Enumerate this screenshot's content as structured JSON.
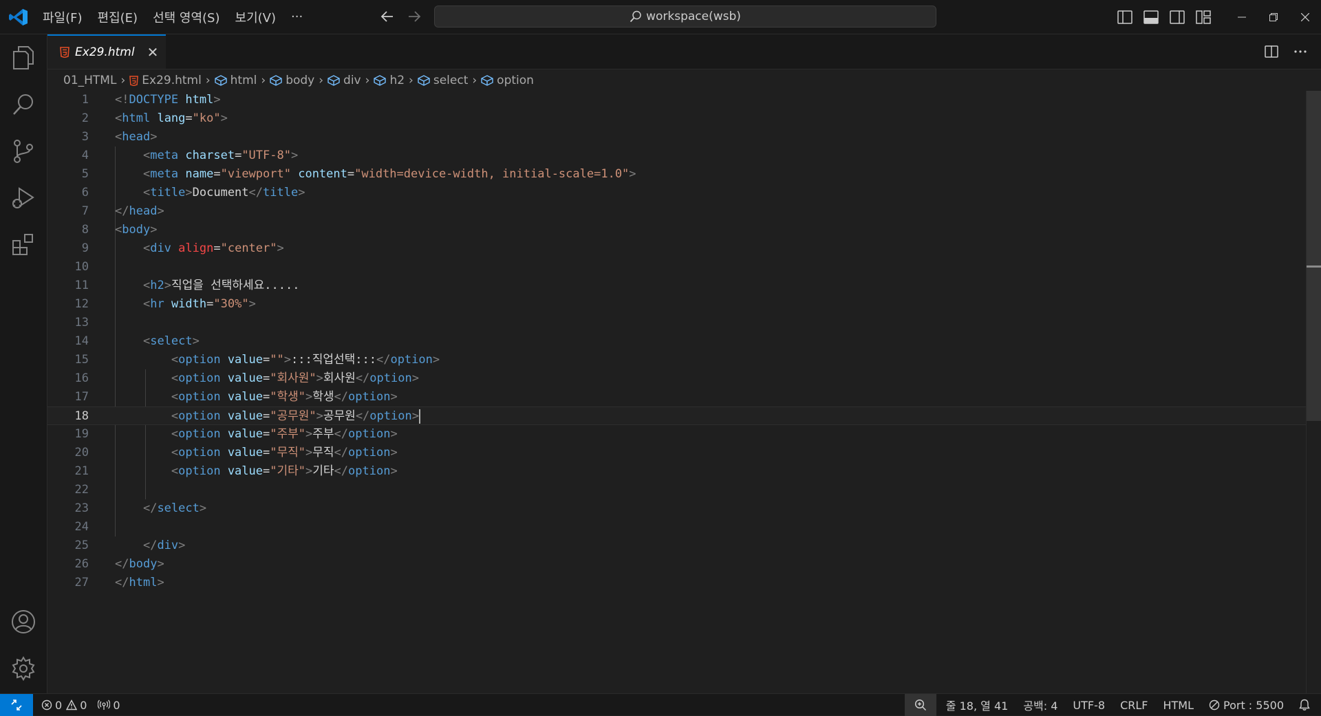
{
  "menu": {
    "items": [
      "파일(F)",
      "편집(E)",
      "선택 영역(S)",
      "보기(V)",
      "···"
    ]
  },
  "search": {
    "text": "workspace(wsb)"
  },
  "tab": {
    "filename": "Ex29.html",
    "close": "✕"
  },
  "breadcrumb": {
    "folder": "01_HTML",
    "file": "Ex29.html",
    "symbols": [
      "html",
      "body",
      "div",
      "h2",
      "select",
      "option"
    ]
  },
  "editor": {
    "active_line": 18,
    "lines": [
      {
        "n": "1",
        "tokens": [
          [
            "br",
            "<!"
          ],
          [
            "tag",
            "DOCTYPE"
          ],
          [
            "txt",
            " "
          ],
          [
            "attr",
            "html"
          ],
          [
            "br",
            ">"
          ]
        ]
      },
      {
        "n": "2",
        "tokens": [
          [
            "br",
            "<"
          ],
          [
            "tag",
            "html"
          ],
          [
            "txt",
            " "
          ],
          [
            "attr",
            "lang"
          ],
          [
            "txt",
            "="
          ],
          [
            "str",
            "\"ko\""
          ],
          [
            "br",
            ">"
          ]
        ]
      },
      {
        "n": "3",
        "tokens": [
          [
            "br",
            "<"
          ],
          [
            "tag",
            "head"
          ],
          [
            "br",
            ">"
          ]
        ]
      },
      {
        "n": "4",
        "tokens": [
          [
            "txt",
            "    "
          ],
          [
            "br",
            "<"
          ],
          [
            "tag",
            "meta"
          ],
          [
            "txt",
            " "
          ],
          [
            "attr",
            "charset"
          ],
          [
            "txt",
            "="
          ],
          [
            "str",
            "\"UTF-8\""
          ],
          [
            "br",
            ">"
          ]
        ]
      },
      {
        "n": "5",
        "tokens": [
          [
            "txt",
            "    "
          ],
          [
            "br",
            "<"
          ],
          [
            "tag",
            "meta"
          ],
          [
            "txt",
            " "
          ],
          [
            "attr",
            "name"
          ],
          [
            "txt",
            "="
          ],
          [
            "str",
            "\"viewport\""
          ],
          [
            "txt",
            " "
          ],
          [
            "attr",
            "content"
          ],
          [
            "txt",
            "="
          ],
          [
            "str",
            "\"width=device-width, initial-scale=1.0\""
          ],
          [
            "br",
            ">"
          ]
        ]
      },
      {
        "n": "6",
        "tokens": [
          [
            "txt",
            "    "
          ],
          [
            "br",
            "<"
          ],
          [
            "tag",
            "title"
          ],
          [
            "br",
            ">"
          ],
          [
            "txt",
            "Document"
          ],
          [
            "br",
            "</"
          ],
          [
            "tag",
            "title"
          ],
          [
            "br",
            ">"
          ]
        ]
      },
      {
        "n": "7",
        "tokens": [
          [
            "br",
            "</"
          ],
          [
            "tag",
            "head"
          ],
          [
            "br",
            ">"
          ]
        ]
      },
      {
        "n": "8",
        "tokens": [
          [
            "br",
            "<"
          ],
          [
            "tag",
            "body"
          ],
          [
            "br",
            ">"
          ]
        ]
      },
      {
        "n": "9",
        "tokens": [
          [
            "txt",
            "    "
          ],
          [
            "br",
            "<"
          ],
          [
            "tag",
            "div"
          ],
          [
            "txt",
            " "
          ],
          [
            "dep",
            "align"
          ],
          [
            "txt",
            "="
          ],
          [
            "str",
            "\"center\""
          ],
          [
            "br",
            ">"
          ]
        ]
      },
      {
        "n": "10",
        "tokens": []
      },
      {
        "n": "11",
        "tokens": [
          [
            "txt",
            "    "
          ],
          [
            "br",
            "<"
          ],
          [
            "tag",
            "h2"
          ],
          [
            "br",
            ">"
          ],
          [
            "txt",
            "직업을 선택하세요....."
          ]
        ]
      },
      {
        "n": "12",
        "tokens": [
          [
            "txt",
            "    "
          ],
          [
            "br",
            "<"
          ],
          [
            "tag",
            "hr"
          ],
          [
            "txt",
            " "
          ],
          [
            "attr",
            "width"
          ],
          [
            "txt",
            "="
          ],
          [
            "str",
            "\"30%\""
          ],
          [
            "br",
            ">"
          ]
        ]
      },
      {
        "n": "13",
        "tokens": []
      },
      {
        "n": "14",
        "tokens": [
          [
            "txt",
            "    "
          ],
          [
            "br",
            "<"
          ],
          [
            "tag",
            "select"
          ],
          [
            "br",
            ">"
          ]
        ]
      },
      {
        "n": "15",
        "tokens": [
          [
            "txt",
            "        "
          ],
          [
            "br",
            "<"
          ],
          [
            "tag",
            "option"
          ],
          [
            "txt",
            " "
          ],
          [
            "attr",
            "value"
          ],
          [
            "txt",
            "="
          ],
          [
            "str",
            "\"\""
          ],
          [
            "br",
            ">"
          ],
          [
            "txt",
            ":::직업선택:::"
          ],
          [
            "br",
            "</"
          ],
          [
            "tag",
            "option"
          ],
          [
            "br",
            ">"
          ]
        ]
      },
      {
        "n": "16",
        "tokens": [
          [
            "txt",
            "        "
          ],
          [
            "br",
            "<"
          ],
          [
            "tag",
            "option"
          ],
          [
            "txt",
            " "
          ],
          [
            "attr",
            "value"
          ],
          [
            "txt",
            "="
          ],
          [
            "str",
            "\"회사원\""
          ],
          [
            "br",
            ">"
          ],
          [
            "txt",
            "회사원"
          ],
          [
            "br",
            "</"
          ],
          [
            "tag",
            "option"
          ],
          [
            "br",
            ">"
          ]
        ]
      },
      {
        "n": "17",
        "tokens": [
          [
            "txt",
            "        "
          ],
          [
            "br",
            "<"
          ],
          [
            "tag",
            "option"
          ],
          [
            "txt",
            " "
          ],
          [
            "attr",
            "value"
          ],
          [
            "txt",
            "="
          ],
          [
            "str",
            "\"학생\""
          ],
          [
            "br",
            ">"
          ],
          [
            "txt",
            "학생"
          ],
          [
            "br",
            "</"
          ],
          [
            "tag",
            "option"
          ],
          [
            "br",
            ">"
          ]
        ]
      },
      {
        "n": "18",
        "tokens": [
          [
            "txt",
            "        "
          ],
          [
            "br",
            "<"
          ],
          [
            "tag",
            "option"
          ],
          [
            "txt",
            " "
          ],
          [
            "attr",
            "value"
          ],
          [
            "txt",
            "="
          ],
          [
            "str",
            "\"공무원\""
          ],
          [
            "br",
            ">"
          ],
          [
            "txt",
            "공무원"
          ],
          [
            "br",
            "</"
          ],
          [
            "tag",
            "option"
          ],
          [
            "br",
            ">"
          ],
          [
            "cursor",
            ""
          ]
        ]
      },
      {
        "n": "19",
        "tokens": [
          [
            "txt",
            "        "
          ],
          [
            "br",
            "<"
          ],
          [
            "tag",
            "option"
          ],
          [
            "txt",
            " "
          ],
          [
            "attr",
            "value"
          ],
          [
            "txt",
            "="
          ],
          [
            "str",
            "\"주부\""
          ],
          [
            "br",
            ">"
          ],
          [
            "txt",
            "주부"
          ],
          [
            "br",
            "</"
          ],
          [
            "tag",
            "option"
          ],
          [
            "br",
            ">"
          ]
        ]
      },
      {
        "n": "20",
        "tokens": [
          [
            "txt",
            "        "
          ],
          [
            "br",
            "<"
          ],
          [
            "tag",
            "option"
          ],
          [
            "txt",
            " "
          ],
          [
            "attr",
            "value"
          ],
          [
            "txt",
            "="
          ],
          [
            "str",
            "\"무직\""
          ],
          [
            "br",
            ">"
          ],
          [
            "txt",
            "무직"
          ],
          [
            "br",
            "</"
          ],
          [
            "tag",
            "option"
          ],
          [
            "br",
            ">"
          ]
        ]
      },
      {
        "n": "21",
        "tokens": [
          [
            "txt",
            "        "
          ],
          [
            "br",
            "<"
          ],
          [
            "tag",
            "option"
          ],
          [
            "txt",
            " "
          ],
          [
            "attr",
            "value"
          ],
          [
            "txt",
            "="
          ],
          [
            "str",
            "\"기타\""
          ],
          [
            "br",
            ">"
          ],
          [
            "txt",
            "기타"
          ],
          [
            "br",
            "</"
          ],
          [
            "tag",
            "option"
          ],
          [
            "br",
            ">"
          ]
        ]
      },
      {
        "n": "22",
        "tokens": []
      },
      {
        "n": "23",
        "tokens": [
          [
            "txt",
            "    "
          ],
          [
            "br",
            "</"
          ],
          [
            "tag",
            "select"
          ],
          [
            "br",
            ">"
          ]
        ]
      },
      {
        "n": "24",
        "tokens": []
      },
      {
        "n": "25",
        "tokens": [
          [
            "txt",
            "    "
          ],
          [
            "br",
            "</"
          ],
          [
            "tag",
            "div"
          ],
          [
            "br",
            ">"
          ]
        ]
      },
      {
        "n": "26",
        "tokens": [
          [
            "br",
            "</"
          ],
          [
            "tag",
            "body"
          ],
          [
            "br",
            ">"
          ]
        ]
      },
      {
        "n": "27",
        "tokens": [
          [
            "br",
            "</"
          ],
          [
            "tag",
            "html"
          ],
          [
            "br",
            ">"
          ]
        ]
      }
    ]
  },
  "status": {
    "errors": "0",
    "warnings": "0",
    "ports_forwarded": "0",
    "cursor_pos": "줄 18, 열 41",
    "indent": "공백: 4",
    "encoding": "UTF-8",
    "eol": "CRLF",
    "language": "HTML",
    "port": "Port : 5500"
  },
  "colors": {
    "accent": "#0078d4",
    "html_icon": "#e44d26",
    "symbol_icon": "#75beff"
  }
}
